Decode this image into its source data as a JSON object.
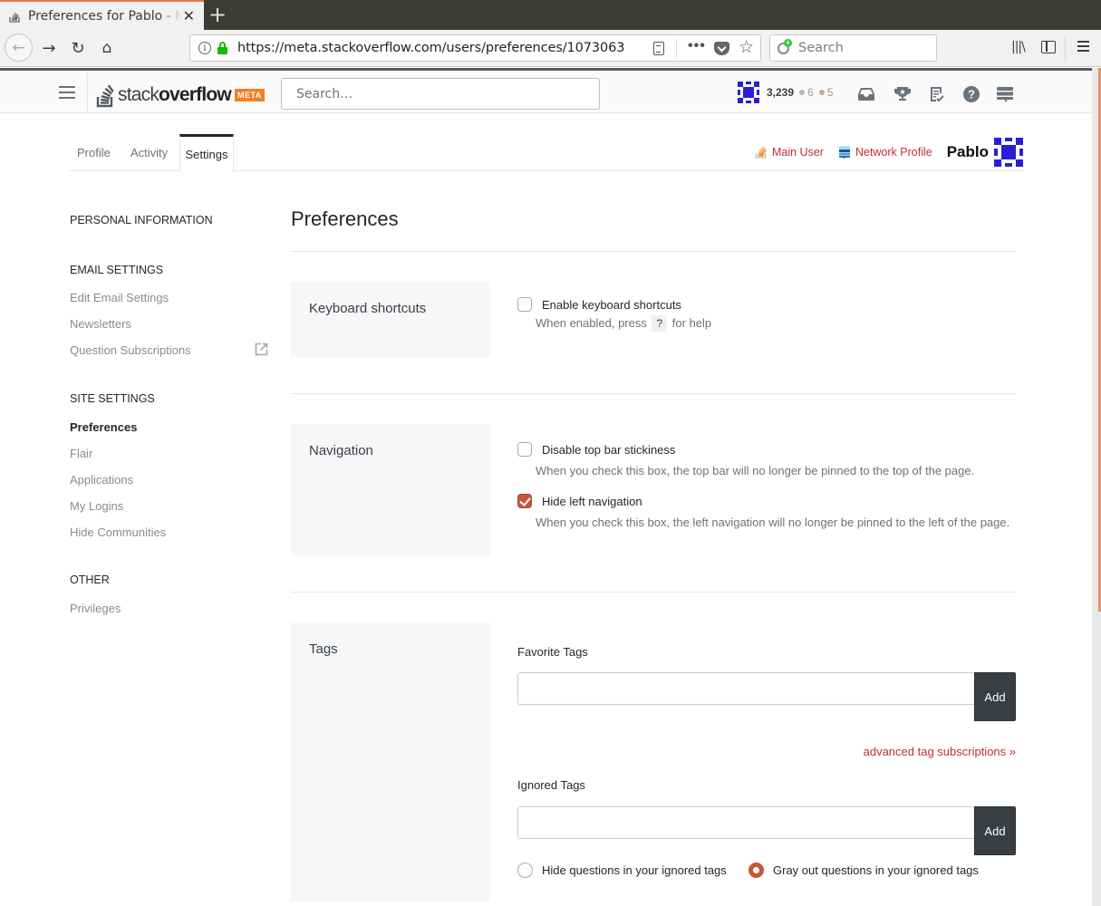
{
  "browser": {
    "tab_title": "Preferences for Pablo - Meta Stack Overflow",
    "new_tab_symbol": "+",
    "close_symbol": "✕",
    "url": "https://meta.stackoverflow.com/users/preferences/1073063",
    "search_placeholder": "Search",
    "icons": {
      "back": "←",
      "forward": "→",
      "reload": "↻",
      "home": "⌂",
      "more": "•••",
      "star": "☆",
      "library": "|||\\"
    }
  },
  "so_topbar": {
    "logo_light": "stack",
    "logo_bold": "overflow",
    "meta_badge": "META",
    "search_placeholder": "Search…",
    "reputation": "3,239",
    "silver_badges": "6",
    "bronze_badges": "5",
    "colors": {
      "accent": "#f48024",
      "topbar_border": "#535a60"
    }
  },
  "profile_tabs": [
    {
      "label": "Profile",
      "active": false
    },
    {
      "label": "Activity",
      "active": false
    },
    {
      "label": "Settings",
      "active": true
    }
  ],
  "profile_links": {
    "main_user": "Main User",
    "network_profile": "Network Profile",
    "display_name": "Pablo"
  },
  "leftnav": {
    "groups": [
      {
        "title": "PERSONAL INFORMATION",
        "items": []
      },
      {
        "title": "EMAIL SETTINGS",
        "items": [
          {
            "label": "Edit Email Settings",
            "active": false
          },
          {
            "label": "Newsletters",
            "active": false
          },
          {
            "label": "Question Subscriptions",
            "active": false,
            "external": true
          }
        ]
      },
      {
        "title": "SITE SETTINGS",
        "items": [
          {
            "label": "Preferences",
            "active": true
          },
          {
            "label": "Flair",
            "active": false
          },
          {
            "label": "Applications",
            "active": false
          },
          {
            "label": "My Logins",
            "active": false
          },
          {
            "label": "Hide Communities",
            "active": false
          }
        ]
      },
      {
        "title": "OTHER",
        "items": [
          {
            "label": "Privileges",
            "active": false
          }
        ]
      }
    ]
  },
  "main": {
    "title": "Preferences",
    "sections": {
      "keyboard": {
        "label": "Keyboard shortcuts",
        "option": {
          "label": "Enable keyboard shortcuts",
          "checked": false
        },
        "desc_before": "When enabled, press",
        "key": "?",
        "desc_after": "for help"
      },
      "navigation": {
        "label": "Navigation",
        "options": [
          {
            "label": "Disable top bar stickiness",
            "checked": false,
            "desc": "When you check this box, the top bar will no longer be pinned to the top of the page."
          },
          {
            "label": "Hide left navigation",
            "checked": true,
            "desc": "When you check this box, the left navigation will no longer be pinned to the left of the page."
          }
        ]
      },
      "tags": {
        "label": "Tags",
        "favorite_label": "Favorite Tags",
        "favorite_value": "",
        "add_label": "Add",
        "advanced_link": "advanced tag subscriptions »",
        "ignored_label": "Ignored Tags",
        "ignored_value": "",
        "radios": [
          {
            "label": "Hide questions in your ignored tags",
            "checked": false
          },
          {
            "label": "Gray out questions in your ignored tags",
            "checked": true
          }
        ]
      }
    },
    "colors": {
      "link": "#c22e32",
      "checked": "#c8553a",
      "add_button": "#393e42"
    }
  }
}
